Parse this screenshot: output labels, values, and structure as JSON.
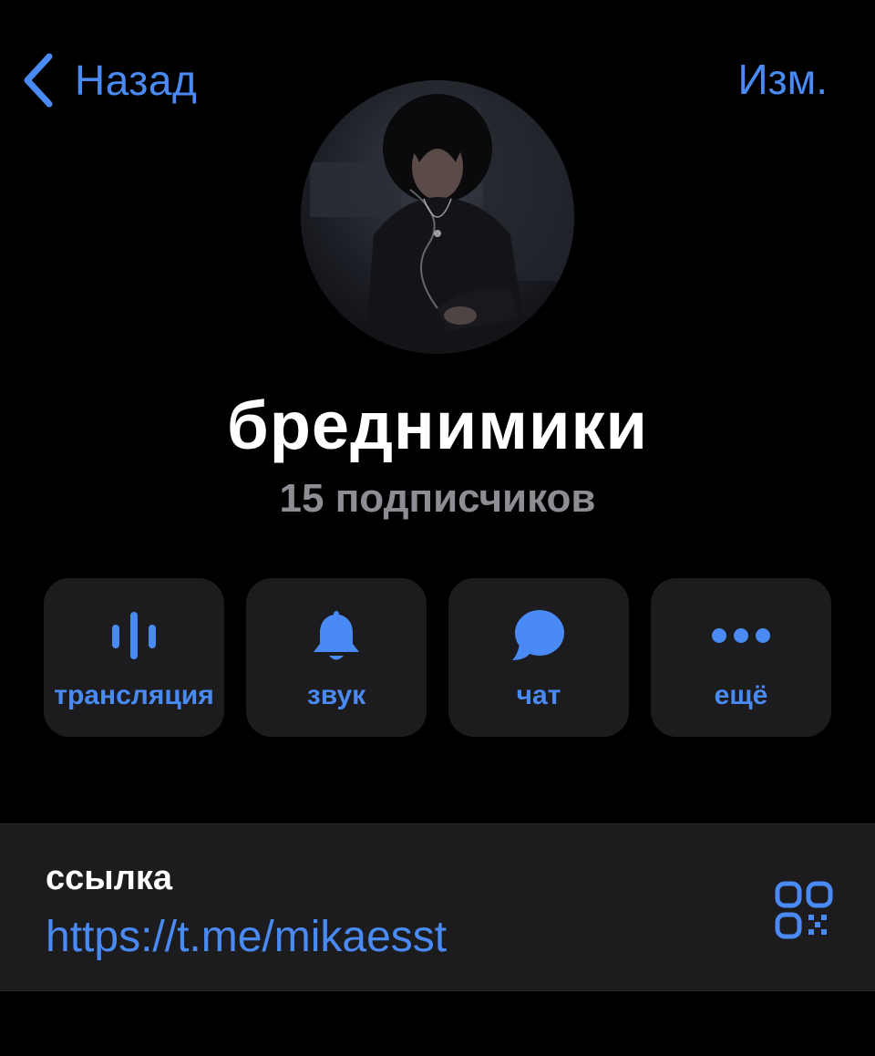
{
  "nav": {
    "back_label": "Назад",
    "edit_label": "Изм."
  },
  "channel": {
    "name": "бреднимики",
    "subscribers": "15 подписчиков"
  },
  "actions": [
    {
      "label": "трансляция",
      "icon": "broadcast-icon"
    },
    {
      "label": "звук",
      "icon": "bell-icon"
    },
    {
      "label": "чат",
      "icon": "chat-bubble-icon"
    },
    {
      "label": "ещё",
      "icon": "more-dots-icon"
    }
  ],
  "link": {
    "caption": "ссылка",
    "url": "https://t.me/mikaesst",
    "icon": "qr-code-icon"
  },
  "colors": {
    "background": "#000000",
    "card": "#1c1c1e",
    "accent": "#4a8af4",
    "secondary_text": "#8d8d93"
  }
}
